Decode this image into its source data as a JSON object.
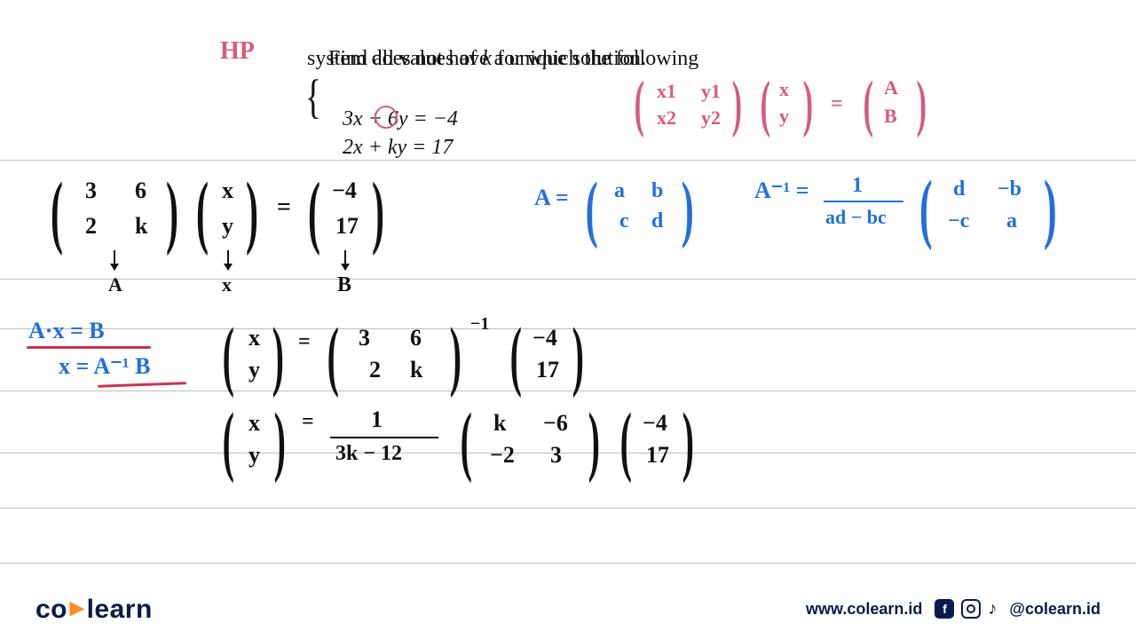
{
  "colors": {
    "hand_black": "#111111",
    "hand_blue": "#1f6fe0",
    "hand_pink": "#d85a7a",
    "underline_red": "#d03050",
    "brand_navy": "#0a1a4a",
    "brand_orange": "#ff8a1f"
  },
  "problem": {
    "line1_a": "Find all values of ",
    "line1_k": "k",
    "line1_b": " for which the following",
    "line2": "system does not have a unique solution.",
    "eq1": "3x + 6y = −4",
    "eq2": "2x + ky = 17"
  },
  "annotations": {
    "hp": "HP",
    "matrix_form_1a": "x1",
    "matrix_form_1b": "y1",
    "matrix_form_2a": "x2",
    "matrix_form_2b": "y2",
    "vec_x": "x",
    "vec_y": "y",
    "rhs_A": "A",
    "rhs_B": "B",
    "A_label": "A",
    "X_label": "x",
    "B_label": "B",
    "blue_line_1": "A·x = B",
    "blue_line_2": "x = A⁻¹ B",
    "A_def_lhs": "A =",
    "A_def_a": "a",
    "A_def_b": "b",
    "A_def_c": "c",
    "A_def_d": "d",
    "Ainv_lhs": "A⁻¹ =",
    "Ainv_denom": "ad − bc",
    "Ainv_num": "1",
    "Ainv_d": "d",
    "Ainv_mb": "−b",
    "Ainv_mc": "−c",
    "Ainv_a": "a"
  },
  "work": {
    "m11": "3",
    "m12": "6",
    "m21": "2",
    "m22": "k",
    "vx": "x",
    "vy": "y",
    "eq_sign": "=",
    "b1": "−4",
    "b2": "17",
    "inv_exp": "−1",
    "frac_1": "1",
    "frac_denom": "3k − 12",
    "adj_11": "k",
    "adj_12": "−6",
    "adj_21": "−2",
    "adj_22": "3",
    "seventeen": "17",
    "neg4": "−4"
  },
  "footer": {
    "logo_co": "co",
    "logo_dot": "·",
    "logo_learn": "learn",
    "url": "www.colearn.id",
    "handle": "@colearn.id"
  }
}
